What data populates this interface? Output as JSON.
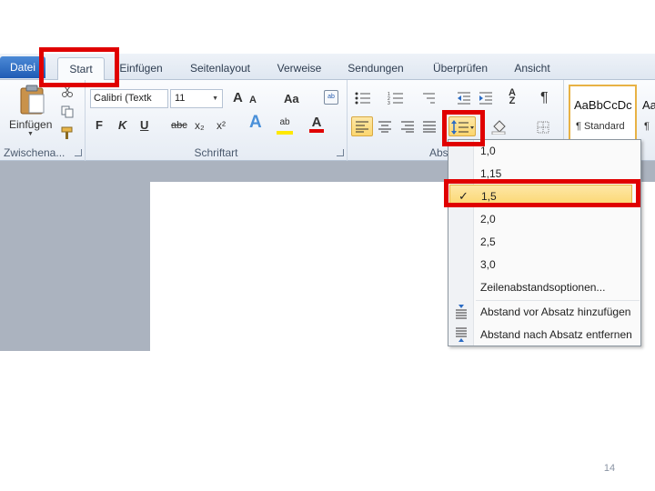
{
  "tabs": {
    "datei": "Datei",
    "start": "Start",
    "einfuegen": "Einfügen",
    "seitenlayout": "Seitenlayout",
    "verweise": "Verweise",
    "sendungen": "Sendungen",
    "ueberpruefen": "Überprüfen",
    "ansicht": "Ansicht"
  },
  "clipboard": {
    "paste_label": "Einfügen",
    "group_label": "Zwischena..."
  },
  "font": {
    "font_name": "Calibri (Textk",
    "font_size": "11",
    "group_label": "Schriftart",
    "bold": "F",
    "italic": "K",
    "underline": "U",
    "strike": "abc",
    "sub": "x₂",
    "sup": "x²",
    "change_case": "Aa",
    "grow": "A",
    "shrink": "A"
  },
  "paragraph": {
    "group_label": "Abs"
  },
  "styles": {
    "sample": "AaBbCcDc",
    "sample2": "Aa",
    "standard": "¶ Standard",
    "standard2": "¶"
  },
  "spacing_menu": {
    "items": [
      "1,0",
      "1,15",
      "1,5",
      "2,0",
      "2,5",
      "3,0"
    ],
    "selected_index": 2,
    "check": "✓",
    "options": "Zeilenabstandsoptionen...",
    "add_before": "Abstand vor Absatz hinzufügen",
    "add_after": "Abstand nach Absatz entfernen"
  },
  "page_number": "14",
  "colors": {
    "highlight_red": "#e00000",
    "selection_yellow": "#fcd66e",
    "file_tab_blue": "#1f5bb5"
  }
}
